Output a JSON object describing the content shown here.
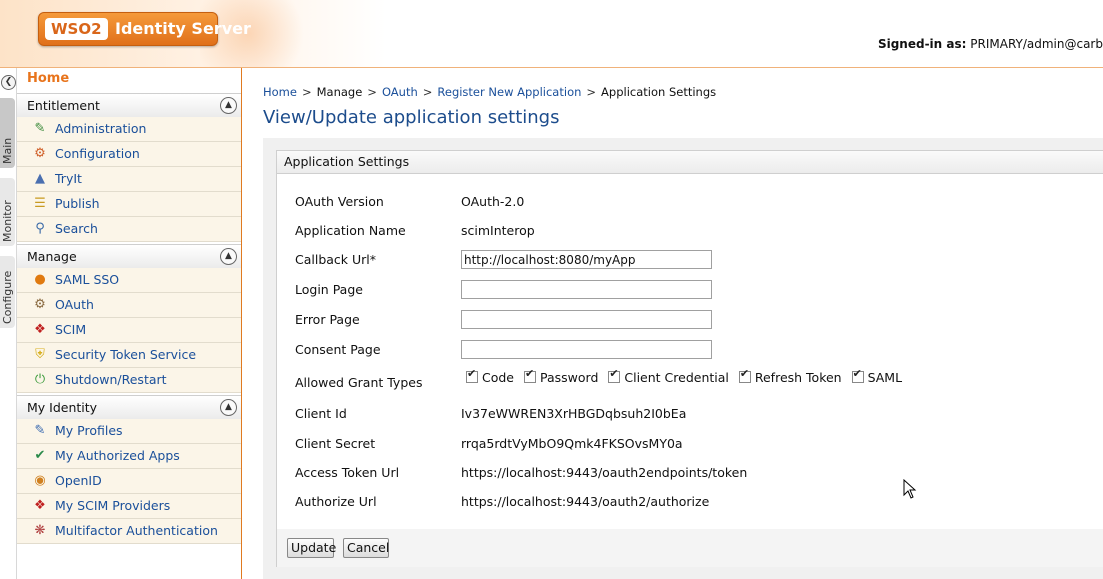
{
  "header": {
    "logo_prefix": "WSO2",
    "logo_text": "Identity Server",
    "signed_in_label": "Signed-in as:",
    "signed_in_user": "PRIMARY/admin@carb"
  },
  "vertical_tabs": [
    "Main",
    "Monitor",
    "Configure"
  ],
  "menu": {
    "home": "Home",
    "sections": [
      {
        "title": "Entitlement",
        "items": [
          {
            "label": "Administration",
            "icon": "administration-icon"
          },
          {
            "label": "Configuration",
            "icon": "configuration-icon"
          },
          {
            "label": "TryIt",
            "icon": "tryit-icon"
          },
          {
            "label": "Publish",
            "icon": "publish-icon"
          },
          {
            "label": "Search",
            "icon": "search-icon"
          }
        ]
      },
      {
        "title": "Manage",
        "items": [
          {
            "label": "SAML SSO",
            "icon": "saml-sso-icon"
          },
          {
            "label": "OAuth",
            "icon": "oauth-icon"
          },
          {
            "label": "SCIM",
            "icon": "scim-icon"
          },
          {
            "label": "Security Token Service",
            "icon": "shield-icon"
          },
          {
            "label": "Shutdown/Restart",
            "icon": "power-icon"
          }
        ]
      },
      {
        "title": "My Identity",
        "items": [
          {
            "label": "My Profiles",
            "icon": "profile-edit-icon"
          },
          {
            "label": "My Authorized Apps",
            "icon": "authorized-apps-icon"
          },
          {
            "label": "OpenID",
            "icon": "openid-icon"
          },
          {
            "label": "My SCIM Providers",
            "icon": "scim-providers-icon"
          },
          {
            "label": "Multifactor Authentication",
            "icon": "multifactor-icon"
          }
        ]
      }
    ]
  },
  "breadcrumb": {
    "home": "Home",
    "manage": "Manage",
    "oauth": "OAuth",
    "register": "Register New Application",
    "current": "Application Settings"
  },
  "page_title": "View/Update application settings",
  "panel": {
    "header": "Application Settings",
    "oauth_version_label": "OAuth Version",
    "oauth_version": "OAuth-2.0",
    "app_name_label": "Application Name",
    "app_name": "scimInterop",
    "callback_label": "Callback Url*",
    "callback_value": "http://localhost:8080/myApp",
    "login_label": "Login Page",
    "login_value": "",
    "error_label": "Error Page",
    "error_value": "",
    "consent_label": "Consent Page",
    "consent_value": "",
    "grant_label": "Allowed Grant Types",
    "grants": [
      "Code",
      "Password",
      "Client Credential",
      "Refresh Token",
      "SAML"
    ],
    "client_id_label": "Client Id",
    "client_id": "Iv37eWWREN3XrHBGDqbsuh2I0bEa",
    "client_secret_label": "Client Secret",
    "client_secret": "rrqa5rdtVyMbO9Qmk4FKSOvsMY0a",
    "access_token_label": "Access Token Url",
    "access_token_url": "https://localhost:9443/oauth2endpoints/token",
    "authorize_label": "Authorize Url",
    "authorize_url": "https://localhost:9443/oauth2/authorize"
  },
  "actions": {
    "update": "Update",
    "cancel": "Cancel"
  }
}
